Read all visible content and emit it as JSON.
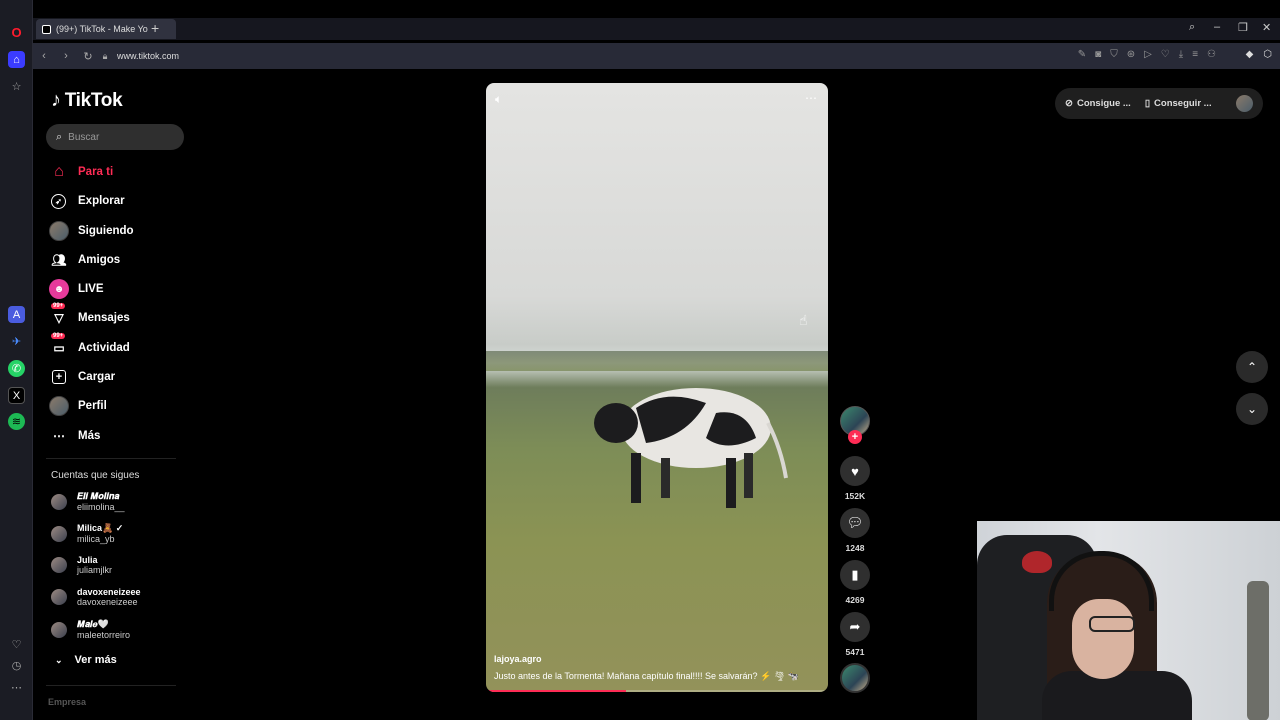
{
  "browser": {
    "tab_title": "(99+) TikTok - Make Yo",
    "url": "www.tiktok.com"
  },
  "tiktok": {
    "logo_text": "TikTok",
    "search_placeholder": "Buscar",
    "nav": [
      {
        "label": "Para ti",
        "icon": "home-icon",
        "active": true
      },
      {
        "label": "Explorar",
        "icon": "compass-icon"
      },
      {
        "label": "Siguiendo",
        "icon": "avatar-icon"
      },
      {
        "label": "Amigos",
        "icon": "friends-icon"
      },
      {
        "label": "LIVE",
        "icon": "live-icon"
      },
      {
        "label": "Mensajes",
        "icon": "message-icon",
        "badge": "99+"
      },
      {
        "label": "Actividad",
        "icon": "activity-icon",
        "badge": "99+"
      },
      {
        "label": "Cargar",
        "icon": "upload-icon"
      },
      {
        "label": "Perfil",
        "icon": "profile-icon"
      },
      {
        "label": "Más",
        "icon": "more-icon"
      }
    ],
    "following_heading": "Cuentas que sigues",
    "following": [
      {
        "display": "𝑬𝒍𝒊 𝑴𝒐𝒍𝒊𝒏𝒂",
        "handle": "eliimolina__"
      },
      {
        "display": "Milica🧸 ✓",
        "handle": "milica_yb"
      },
      {
        "display": "Julia",
        "handle": "juliamjlkr"
      },
      {
        "display": "davoxeneizeee",
        "handle": "davoxeneizeee"
      },
      {
        "display": "𝑴𝒂𝒍𝒆🤍",
        "handle": "maleetorreiro"
      }
    ],
    "see_more": "Ver más",
    "footer_partial": "Empresa"
  },
  "video": {
    "username": "lajoya.agro",
    "caption": "Justo antes de la Tormenta! Mañana capítulo final!!!! Se salvarán? ⚡ 🌪 🐄",
    "progress": 0.41,
    "likes": "152K",
    "comments": "1248",
    "saves": "4269",
    "shares": "5471"
  },
  "top_right": {
    "get_coins": "Consigue ...",
    "get_app": "Conseguir ..."
  }
}
